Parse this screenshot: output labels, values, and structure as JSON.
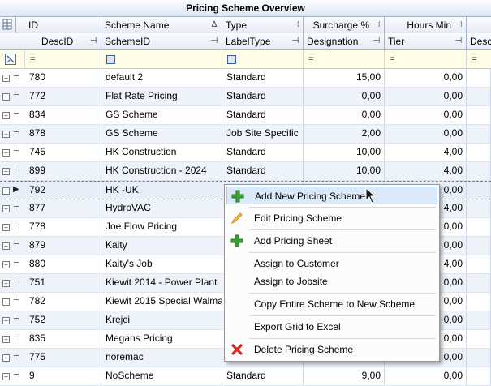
{
  "title": "Pricing Scheme Overview",
  "header_row1": [
    "ID",
    "Scheme Name",
    "Type",
    "Surcharge %",
    "Hours Min"
  ],
  "header_row2": [
    "DescID",
    "SchemeID",
    "LabelType",
    "Designation",
    "Tier",
    "Desc"
  ],
  "sort_indicator": "Δ",
  "filter_eq": "=",
  "rows": [
    {
      "id": "780",
      "name": "default 2",
      "type": "Standard",
      "surcharge": "15,00",
      "hours": "0,00"
    },
    {
      "id": "772",
      "name": "Flat Rate Pricing",
      "type": "Standard",
      "surcharge": "0,00",
      "hours": "0,00"
    },
    {
      "id": "834",
      "name": "GS Scheme",
      "type": "Standard",
      "surcharge": "0,00",
      "hours": "0,00"
    },
    {
      "id": "878",
      "name": "GS Scheme",
      "type": "Job Site Specific",
      "surcharge": "2,00",
      "hours": "0,00"
    },
    {
      "id": "745",
      "name": "HK Construction",
      "type": "Standard",
      "surcharge": "10,00",
      "hours": "4,00"
    },
    {
      "id": "899",
      "name": "HK Construction - 2024",
      "type": "Standard",
      "surcharge": "10,00",
      "hours": "4,00"
    },
    {
      "id": "792",
      "name": "HK -UK",
      "type": "",
      "surcharge": "",
      "hours": "0,00"
    },
    {
      "id": "877",
      "name": "HydroVAC",
      "type": "",
      "surcharge": "",
      "hours": "4,00"
    },
    {
      "id": "778",
      "name": "Joe Flow Pricing",
      "type": "",
      "surcharge": "",
      "hours": "0,00"
    },
    {
      "id": "879",
      "name": "Kaity",
      "type": "",
      "surcharge": "",
      "hours": "0,00"
    },
    {
      "id": "880",
      "name": "Kaity's Job",
      "type": "",
      "surcharge": "",
      "hours": "4,00"
    },
    {
      "id": "751",
      "name": "Kiewit 2014 - Power Plant",
      "type": "",
      "surcharge": "",
      "hours": "0,00"
    },
    {
      "id": "782",
      "name": "Kiewit 2015 Special Walmar",
      "type": "",
      "surcharge": "",
      "hours": "0,00"
    },
    {
      "id": "752",
      "name": "Krejci",
      "type": "",
      "surcharge": "",
      "hours": "0,00"
    },
    {
      "id": "835",
      "name": "Megans Pricing",
      "type": "",
      "surcharge": "",
      "hours": "0,00"
    },
    {
      "id": "775",
      "name": "noremac",
      "type": "",
      "surcharge": "",
      "hours": "0,00"
    },
    {
      "id": "9",
      "name": "NoScheme",
      "type": "Standard",
      "surcharge": "9,00",
      "hours": "0,00"
    }
  ],
  "context_menu": [
    {
      "label": "Add New Pricing Scheme",
      "icon": "plus-icon",
      "color": "#3aa02f"
    },
    {
      "label": "Edit Pricing Scheme",
      "icon": "pencil-icon",
      "color": "#e2a13a"
    },
    {
      "label": "Add Pricing Sheet",
      "icon": "plus-icon",
      "color": "#3aa02f"
    },
    {
      "label": "Assign to Customer",
      "icon": "",
      "color": ""
    },
    {
      "label": "Assign to Jobsite",
      "icon": "",
      "color": ""
    },
    {
      "label": "Copy Entire Scheme to New Scheme",
      "icon": "",
      "color": ""
    },
    {
      "label": "Export Grid to Excel",
      "icon": "",
      "color": ""
    },
    {
      "label": "Delete Pricing Scheme",
      "icon": "delete-x-icon",
      "color": "#d42a1f"
    }
  ],
  "colors": {
    "accent": "#dbe9f9",
    "alt_row": "#eef2f9",
    "filter_bg": "#fffde6",
    "header_border": "#a7b5cb"
  }
}
